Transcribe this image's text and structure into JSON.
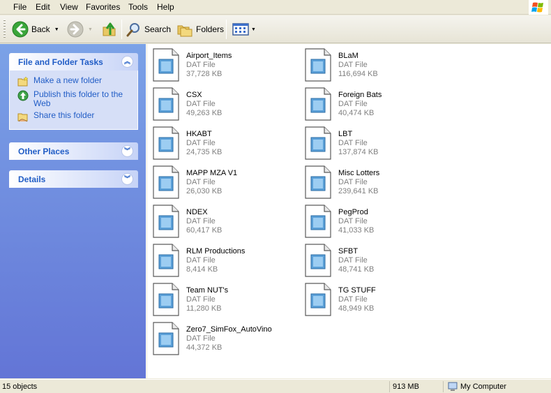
{
  "menu": [
    "File",
    "Edit",
    "View",
    "Favorites",
    "Tools",
    "Help"
  ],
  "toolbar": {
    "back_label": "Back",
    "search_label": "Search",
    "folders_label": "Folders"
  },
  "tasks_panel": {
    "title": "File and Folder Tasks",
    "items": [
      {
        "label": "Make a new folder",
        "icon": "new-folder-icon"
      },
      {
        "label": "Publish this folder to the Web",
        "icon": "publish-web-icon"
      },
      {
        "label": "Share this folder",
        "icon": "share-folder-icon"
      }
    ]
  },
  "other_places_panel": {
    "title": "Other Places"
  },
  "details_panel": {
    "title": "Details"
  },
  "files": [
    {
      "name": "Airport_Items",
      "type": "DAT File",
      "size": "37,728 KB"
    },
    {
      "name": "BLaM",
      "type": "DAT File",
      "size": "116,694 KB"
    },
    {
      "name": "CSX",
      "type": "DAT File",
      "size": "49,263 KB"
    },
    {
      "name": "Foreign Bats",
      "type": "DAT File",
      "size": "40,474 KB"
    },
    {
      "name": "HKABT",
      "type": "DAT File",
      "size": "24,735 KB"
    },
    {
      "name": "LBT",
      "type": "DAT File",
      "size": "137,874 KB"
    },
    {
      "name": "MAPP MZA V1",
      "type": "DAT File",
      "size": "26,030 KB"
    },
    {
      "name": "Misc Lotters",
      "type": "DAT File",
      "size": "239,641 KB"
    },
    {
      "name": "NDEX",
      "type": "DAT File",
      "size": "60,417 KB"
    },
    {
      "name": "PegProd",
      "type": "DAT File",
      "size": "41,033 KB"
    },
    {
      "name": "RLM Productions",
      "type": "DAT File",
      "size": "8,414 KB"
    },
    {
      "name": "SFBT",
      "type": "DAT File",
      "size": "48,741 KB"
    },
    {
      "name": "Team NUT's",
      "type": "DAT File",
      "size": "11,280 KB"
    },
    {
      "name": "TG STUFF",
      "type": "DAT File",
      "size": "48,949 KB"
    },
    {
      "name": "Zero7_SimFox_AutoVino",
      "type": "DAT File",
      "size": "44,372 KB"
    }
  ],
  "status": {
    "objects": "15 objects",
    "size": "913 MB",
    "location": "My Computer"
  },
  "colors": {
    "taskpane_top": "#7BA2E7",
    "taskpane_bottom": "#6375D6",
    "panel_title": "#215DC6",
    "chrome": "#ECE9D8",
    "detail_text": "#808080"
  }
}
